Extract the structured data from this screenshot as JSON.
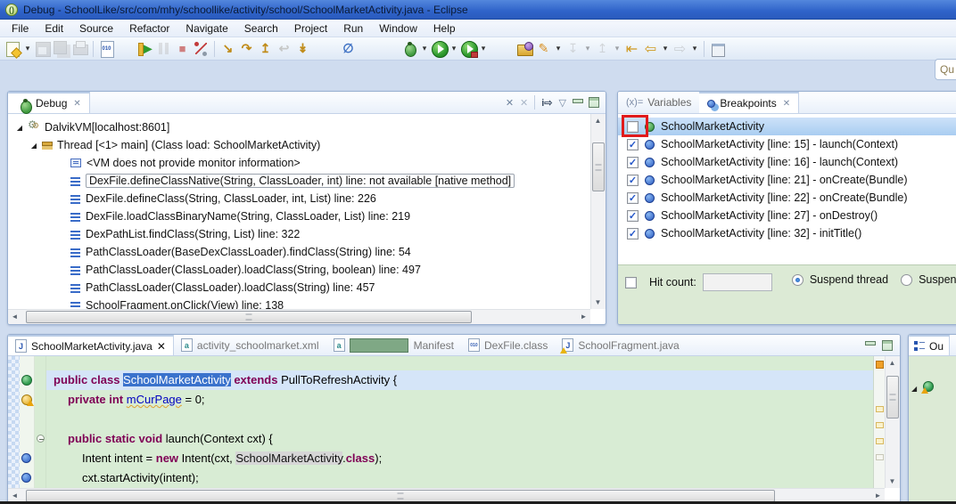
{
  "window": {
    "title": "Debug - SchoolLike/src/com/mhy/schoollike/activity/school/SchoolMarketActivity.java - Eclipse"
  },
  "menubar": {
    "items": [
      "File",
      "Edit",
      "Source",
      "Refactor",
      "Navigate",
      "Search",
      "Project",
      "Run",
      "Window",
      "Help"
    ]
  },
  "toolbar": {
    "quick_access": "Qu",
    "items": [
      {
        "n": "new-wizard",
        "k": "new"
      },
      {
        "n": "new-wizard-dropdown",
        "k": "dd",
        "g": "▾"
      },
      {
        "n": "save",
        "k": "save",
        "dis": true
      },
      {
        "n": "save-all",
        "k": "saveall",
        "dis": true
      },
      {
        "n": "print",
        "k": "print",
        "dis": true
      },
      {
        "sep": true
      },
      {
        "n": "binary-file",
        "k": "file010",
        "g": "010"
      },
      {
        "gap": 22
      },
      {
        "n": "resume",
        "k": "resume",
        "g": "▶"
      },
      {
        "n": "suspend",
        "k": "pause",
        "dis": true
      },
      {
        "n": "terminate",
        "k": "stop",
        "g": "■"
      },
      {
        "n": "disconnect",
        "k": "disc"
      },
      {
        "sep": true
      },
      {
        "n": "step-into",
        "k": "gold",
        "g": "↘"
      },
      {
        "n": "step-over",
        "k": "gold",
        "g": "↷"
      },
      {
        "n": "step-return",
        "k": "gold",
        "g": "↥"
      },
      {
        "n": "drop-to-frame",
        "k": "gold",
        "g": "↩",
        "dis": true
      },
      {
        "n": "use-step-filters",
        "k": "gold",
        "g": "↡"
      },
      {
        "gap": 30
      },
      {
        "n": "skip-all-breakpoints",
        "k": "skip",
        "g": "∅"
      },
      {
        "gap": 48
      },
      {
        "n": "debug",
        "k": "bug"
      },
      {
        "n": "debug-dropdown",
        "k": "dd",
        "g": "▾"
      },
      {
        "n": "run",
        "k": "run"
      },
      {
        "n": "run-dropdown",
        "k": "dd",
        "g": "▾"
      },
      {
        "n": "external-tools",
        "k": "run ext"
      },
      {
        "n": "external-tools-dropdown",
        "k": "dd",
        "g": "▾"
      },
      {
        "gap": 30
      },
      {
        "n": "open-type",
        "k": "folder"
      },
      {
        "n": "mark-occurrences",
        "k": "marker",
        "g": "✎"
      },
      {
        "n": "mark-occurrences-dropdown",
        "k": "dd",
        "g": "▾"
      },
      {
        "n": "next-annotation",
        "k": "anno",
        "g": "↧",
        "dis": true
      },
      {
        "n": "next-annotation-dropdown",
        "k": "dd",
        "g": "▾",
        "dis": true
      },
      {
        "n": "previous-annotation",
        "k": "anno",
        "g": "↥",
        "dis": true
      },
      {
        "n": "previous-annotation-dropdown",
        "k": "dd",
        "g": "▾",
        "dis": true
      },
      {
        "n": "last-edit-location",
        "k": "gold2",
        "g": "⇤"
      },
      {
        "n": "back",
        "k": "gold2",
        "g": "⇦"
      },
      {
        "n": "back-dropdown",
        "k": "dd",
        "g": "▾"
      },
      {
        "n": "forward",
        "k": "grey2",
        "g": "⇨",
        "dis": true
      },
      {
        "n": "forward-dropdown",
        "k": "dd",
        "g": "▾"
      },
      {
        "sep": true
      },
      {
        "n": "restore-window",
        "k": "winres"
      }
    ]
  },
  "icons": {
    "close": "✕",
    "dropdown": "▾",
    "view_menu": "▽",
    "focus_arrow": "i⇨",
    "clear_terminated": "✕",
    "disconnect_small": "✕",
    "variables_tab": "(x)=",
    "expanded": "◢",
    "check": "✓"
  },
  "debug": {
    "tab": "Debug",
    "tree": [
      {
        "level": 1,
        "arrow": true,
        "icon": "jvm",
        "text": "DalvikVM[localhost:8601]"
      },
      {
        "level": 2,
        "arrow": true,
        "icon": "thread",
        "text": "Thread [<1> main] (Class load: SchoolMarketActivity)"
      },
      {
        "level": 3,
        "icon": "monitor",
        "text": "<VM does not provide monitor information>"
      },
      {
        "level": 3,
        "icon": "frame",
        "selected": true,
        "text": "DexFile.defineClassNative(String, ClassLoader, int) line: not available [native method]"
      },
      {
        "level": 3,
        "icon": "frame",
        "text": "DexFile.defineClass(String, ClassLoader, int, List) line: 226"
      },
      {
        "level": 3,
        "icon": "frame",
        "text": "DexFile.loadClassBinaryName(String, ClassLoader, List) line: 219"
      },
      {
        "level": 3,
        "icon": "frame",
        "text": "DexPathList.findClass(String, List) line: 322"
      },
      {
        "level": 3,
        "icon": "frame",
        "text": "PathClassLoader(BaseDexClassLoader).findClass(String) line: 54"
      },
      {
        "level": 3,
        "icon": "frame",
        "text": "PathClassLoader(ClassLoader).loadClass(String, boolean) line: 497"
      },
      {
        "level": 3,
        "icon": "frame",
        "text": "PathClassLoader(ClassLoader).loadClass(String) line: 457"
      },
      {
        "level": 3,
        "icon": "frame",
        "text": "SchoolFragment.onClick(View) line: 138"
      }
    ]
  },
  "breakpoints": {
    "variables_tab_label": "Variables",
    "breakpoints_tab_label": "Breakpoints",
    "rows": [
      {
        "checked": false,
        "icon": "class-bp",
        "selected": true,
        "annotated": true,
        "text": "SchoolMarketActivity"
      },
      {
        "checked": true,
        "icon": "line-bp",
        "text": "SchoolMarketActivity [line: 15] - launch(Context)"
      },
      {
        "checked": true,
        "icon": "line-bp",
        "text": "SchoolMarketActivity [line: 16] - launch(Context)"
      },
      {
        "checked": true,
        "icon": "line-bp",
        "text": "SchoolMarketActivity [line: 21] - onCreate(Bundle)"
      },
      {
        "checked": true,
        "icon": "line-bp",
        "text": "SchoolMarketActivity [line: 22] - onCreate(Bundle)"
      },
      {
        "checked": true,
        "icon": "line-bp",
        "text": "SchoolMarketActivity [line: 27] - onDestroy()"
      },
      {
        "checked": true,
        "icon": "line-bp",
        "text": "SchoolMarketActivity [line: 32] - initTitle()"
      }
    ],
    "detail": {
      "hit_count_label": "Hit count:",
      "hit_count_value": "",
      "suspend_thread_label": "Suspend thread",
      "suspend_vm_label": "Suspend VM",
      "suspend_mode": "thread"
    }
  },
  "editor": {
    "tabs": [
      {
        "label": "SchoolMarketActivity.java",
        "icon": "java-file",
        "active": true,
        "closable": true
      },
      {
        "label": "activity_schoolmarket.xml",
        "icon": "xml-file"
      },
      {
        "label": "Manifest",
        "icon": "xml-file",
        "redacted": true
      },
      {
        "label": "DexFile.class",
        "icon": "class-file"
      },
      {
        "label": "SchoolFragment.java",
        "icon": "java-file-warning"
      }
    ],
    "file_icon_glyphs": {
      "java-file": "J",
      "java-file-warning": "J",
      "xml-file": "a",
      "class-file": "010"
    },
    "lines": [
      {
        "indent": 0,
        "current": true,
        "marker": "class-load",
        "tokens": [
          [
            "kw",
            "public class "
          ],
          [
            "selhl",
            "SchoolMarketActivity"
          ],
          [
            "pl",
            " "
          ],
          [
            "kw",
            "extends"
          ],
          [
            "pl",
            " PullToRefreshActivity {"
          ]
        ]
      },
      {
        "indent": 1,
        "marker": "warning",
        "tokens": [
          [
            "kw",
            "private int "
          ],
          [
            "field warn",
            "mCurPage"
          ],
          [
            "pl",
            " = 0;"
          ]
        ]
      },
      {
        "indent": 0,
        "tokens": []
      },
      {
        "indent": 1,
        "marker": "fold",
        "tokens": [
          [
            "kw",
            "public static void "
          ],
          [
            "pl",
            "launch(Context cxt) {"
          ]
        ]
      },
      {
        "indent": 2,
        "marker": "breakpoint",
        "tokens": [
          [
            "pl",
            "Intent intent = "
          ],
          [
            "kw",
            "new"
          ],
          [
            "pl",
            " Intent(cxt, "
          ],
          [
            "occ",
            "SchoolMarketActivity"
          ],
          [
            "pl",
            "."
          ],
          [
            "kw",
            "class"
          ],
          [
            "pl",
            ");"
          ]
        ]
      },
      {
        "indent": 2,
        "marker": "breakpoint",
        "tokens": [
          [
            "pl",
            "cxt.startActivity(intent);"
          ]
        ]
      },
      {
        "indent": 1,
        "tokens": [
          [
            "pl",
            "}"
          ]
        ]
      }
    ]
  },
  "outline": {
    "tab": "Ou"
  },
  "colors": {
    "title_bar": "#3d6fd2",
    "keyword": "#7f0055",
    "field": "#0000c0",
    "editor_bg": "#d8ecd4",
    "selection": "#3a72cc",
    "detail_bg": "#dcead5",
    "annotation_red": "#e11b1b",
    "redaction_green": "#7fa885"
  }
}
